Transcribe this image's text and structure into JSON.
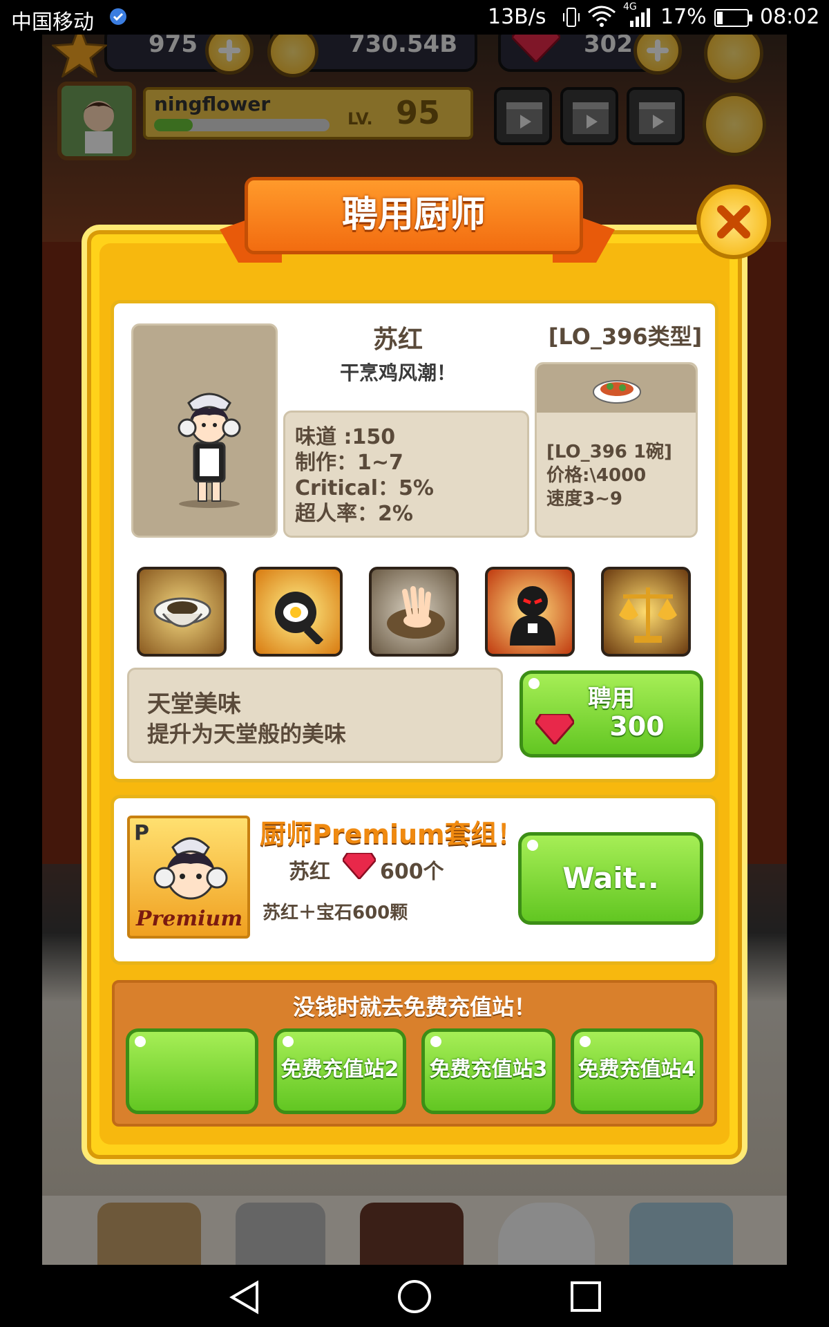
{
  "status_bar": {
    "carrier": "中国移动",
    "speed": "13B/s",
    "network": "4G",
    "battery": "17%",
    "time": "08:02"
  },
  "hud": {
    "stars": "975",
    "coins": "730.54B",
    "gems": "302",
    "player_name": "ningflower",
    "level_label": "LV.",
    "level": "95",
    "xp_fraction": 0.22
  },
  "dialog": {
    "title": "聘用厨师",
    "chef": {
      "name": "苏红",
      "slogan": "干烹鸡风潮！",
      "type_label": "[LO_396类型]",
      "stats": {
        "taste": "味道 :150",
        "make": "制作：1~7",
        "critical": "Critical：5%",
        "super": "超人率：2%"
      },
      "dish": {
        "name": "[LO_396 1碗]",
        "price": "价格:\\4000",
        "speed": "速度3~9"
      }
    },
    "skills": [
      "bowl-skill-icon",
      "frying-pan-skill-icon",
      "hand-stir-skill-icon",
      "shadow-chef-skill-icon",
      "scales-skill-icon"
    ],
    "skill_desc": {
      "title": "天堂美味",
      "text": "提升为天堂般的美味"
    },
    "hire": {
      "label": "聘用",
      "price": "300"
    },
    "premium": {
      "badge": "P",
      "card_text": "Premium",
      "title": "厨师Premium套组！",
      "chef": "苏红",
      "gems": "600个",
      "desc": "苏红＋宝石600颗",
      "button": "Wait.."
    },
    "recharge": {
      "title": "没钱时就去免费充值站！",
      "buttons": [
        "",
        "免费充值站2",
        "免费充值站3",
        "免费充值站4"
      ]
    }
  },
  "colors": {
    "accent_orange": "#f26c10",
    "frame_yellow": "#ffd21a",
    "button_green": "#62c622",
    "gem_red": "#e8284a"
  }
}
